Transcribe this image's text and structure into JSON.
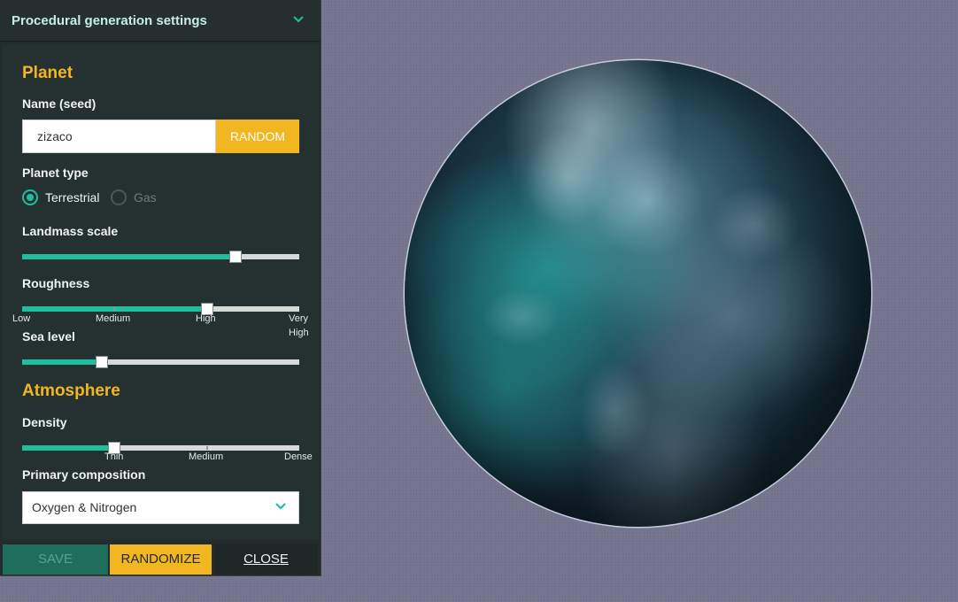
{
  "panel": {
    "title": "Procedural generation settings",
    "planet_section": "Planet",
    "seed_label": "Name (seed)",
    "seed_value": "zizaco",
    "random_label": "RANDOM",
    "planet_type_label": "Planet type",
    "planet_types": [
      {
        "label": "Terrestrial",
        "selected": true
      },
      {
        "label": "Gas",
        "selected": false
      }
    ],
    "landmass_label": "Landmass scale",
    "landmass_value": 0.77,
    "roughness_label": "Roughness",
    "roughness_value": 0.667,
    "roughness_ticks": [
      "Low",
      "Medium",
      "High",
      "Very",
      "High"
    ],
    "sea_label": "Sea level",
    "sea_value": 0.29,
    "atmosphere_section": "Atmosphere",
    "density_label": "Density",
    "density_value": 0.333,
    "density_ticks": [
      "Thin",
      "Medium",
      "Dense"
    ],
    "composition_label": "Primary composition",
    "composition_value": "Oxygen & Nitrogen"
  },
  "footer": {
    "save_label": "SAVE",
    "randomize_label": "RANDOMIZE",
    "close_label": "CLOSE"
  },
  "colors": {
    "accent": "#1fbf9e",
    "highlight": "#f2b620",
    "panel": "#232b2c",
    "background": "#76758f"
  },
  "icons": {
    "header_toggle": "chevron-down-icon",
    "select_toggle": "chevron-down-icon"
  }
}
